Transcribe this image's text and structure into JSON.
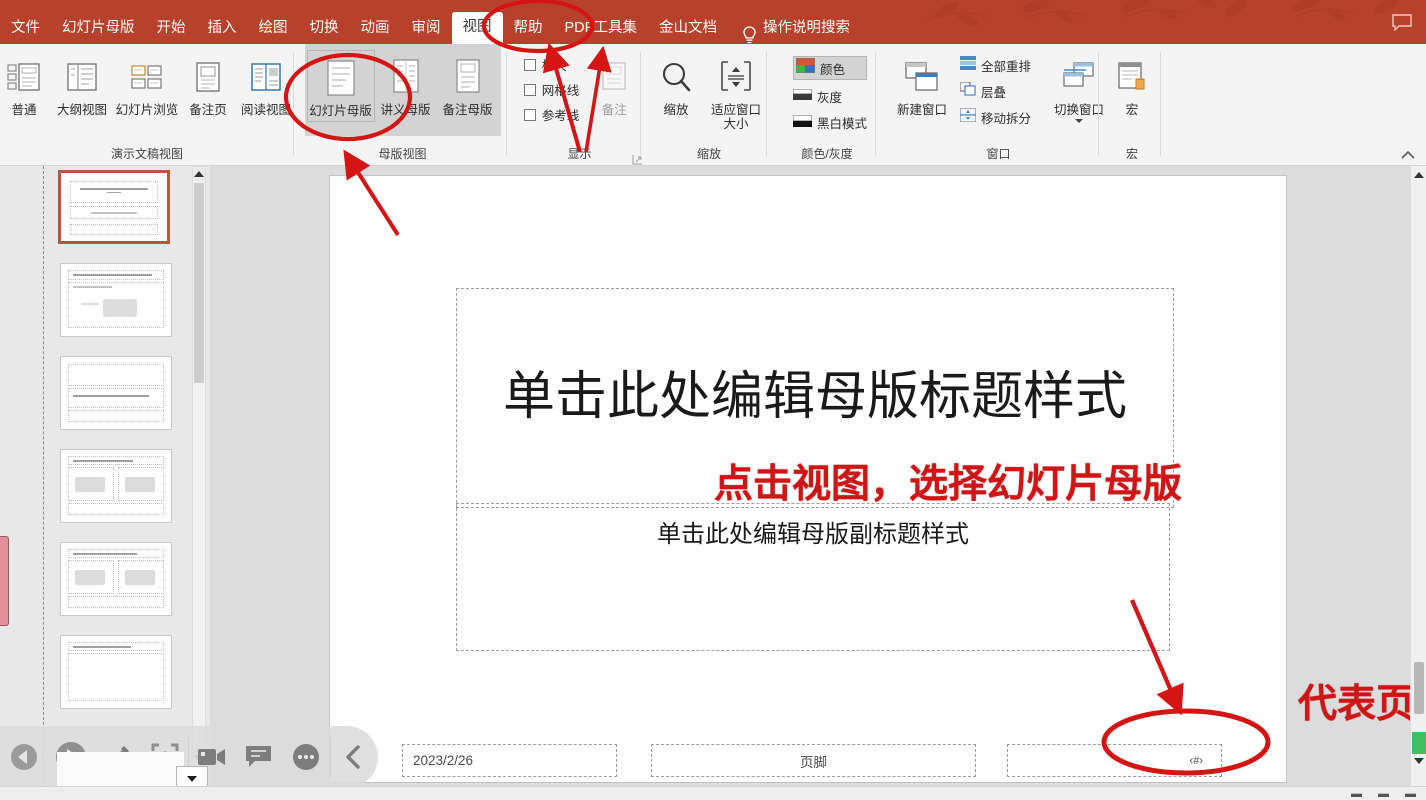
{
  "header": {
    "menu_items": [
      {
        "label": "文件",
        "active": false
      },
      {
        "label": "幻灯片母版",
        "active": false
      },
      {
        "label": "开始",
        "active": false
      },
      {
        "label": "插入",
        "active": false
      },
      {
        "label": "绘图",
        "active": false
      },
      {
        "label": "切换",
        "active": false
      },
      {
        "label": "动画",
        "active": false
      },
      {
        "label": "审阅",
        "active": false
      },
      {
        "label": "视图",
        "active": true
      },
      {
        "label": "帮助",
        "active": false
      },
      {
        "label": "PDF工具集",
        "active": false
      },
      {
        "label": "金山文档",
        "active": false
      }
    ],
    "search_hint": "操作说明搜索",
    "bulb_icon": "lightbulb-icon",
    "share_icon": "comment-share-icon",
    "background_color": "#b7412a"
  },
  "ribbon": {
    "groups": [
      {
        "name": "presentation-views",
        "label": "演示文稿视图",
        "buttons": [
          {
            "label": "普通",
            "icon": "normal-view-icon",
            "active": false
          },
          {
            "label": "大纲视图",
            "icon": "outline-view-icon",
            "active": false
          },
          {
            "label": "幻灯片浏览",
            "icon": "slide-sorter-icon",
            "active": false
          },
          {
            "label": "备注页",
            "icon": "notes-page-icon",
            "active": false
          },
          {
            "label": "阅读视图",
            "icon": "reading-view-icon",
            "active": false
          }
        ]
      },
      {
        "name": "master-views",
        "label": "母版视图",
        "buttons": [
          {
            "label": "幻灯片母版",
            "icon": "slide-master-icon",
            "active": true
          },
          {
            "label": "讲义母版",
            "icon": "handout-master-icon",
            "active": false
          },
          {
            "label": "备注母版",
            "icon": "notes-master-icon",
            "active": false
          }
        ]
      },
      {
        "name": "display",
        "label": "显示",
        "checkboxes": [
          {
            "label": "标尺",
            "checked": false
          },
          {
            "label": "网格线",
            "checked": false
          },
          {
            "label": "参考线",
            "checked": false
          }
        ],
        "buttons": [
          {
            "label": "备注",
            "icon": "notes-icon",
            "disabled": true
          }
        ],
        "has_dialog_launcher": true
      },
      {
        "name": "zoom",
        "label": "缩放",
        "buttons": [
          {
            "label": "缩放",
            "icon": "magnifier-icon"
          },
          {
            "label": "适应窗口大小",
            "icon": "fit-window-icon"
          }
        ]
      },
      {
        "name": "color-grayscale",
        "label": "颜色/灰度",
        "items": [
          {
            "label": "颜色",
            "icon": "color-swatch-icon",
            "active": true
          },
          {
            "label": "灰度",
            "icon": "grayscale-icon",
            "active": false
          },
          {
            "label": "黑白模式",
            "icon": "blackwhite-icon",
            "active": false
          }
        ]
      },
      {
        "name": "window",
        "label": "窗口",
        "buttons": [
          {
            "label": "新建窗口",
            "icon": "new-window-icon"
          }
        ],
        "items": [
          {
            "label": "全部重排",
            "icon": "arrange-all-icon"
          },
          {
            "label": "层叠",
            "icon": "cascade-icon"
          },
          {
            "label": "移动拆分",
            "icon": "move-split-icon"
          },
          {
            "label": "切换窗口",
            "icon": "switch-window-icon"
          }
        ]
      },
      {
        "name": "macros",
        "label": "宏",
        "buttons": [
          {
            "label": "宏",
            "icon": "macro-icon"
          }
        ]
      }
    ],
    "collapse_icon": "chevron-up-icon"
  },
  "slide_panel": {
    "selected_index": 0,
    "scrollbar": {
      "up": "triangle-up-icon",
      "down": "triangle-down-icon"
    },
    "thumbnails": [
      {
        "name": "slide-thumbnail-1",
        "selected": true
      },
      {
        "name": "slide-thumbnail-2",
        "selected": false
      },
      {
        "name": "slide-thumbnail-3",
        "selected": false
      },
      {
        "name": "slide-thumbnail-4",
        "selected": false
      },
      {
        "name": "slide-thumbnail-5",
        "selected": false
      },
      {
        "name": "slide-thumbnail-6",
        "selected": false
      }
    ]
  },
  "slide": {
    "title_placeholder": "单击此处编辑母版标题样式",
    "subtitle_placeholder": "单击此处编辑母版副标题样式",
    "footer_date": "2023/2/26",
    "footer_center": "页脚",
    "footer_number": "‹#›"
  },
  "annotations": {
    "instruction": "点击视图，选择幻灯片母版",
    "page_number_note": "代表页码",
    "color": "#cf1616",
    "shapes": [
      {
        "type": "ellipse",
        "name": "ellipse-view-tab"
      },
      {
        "type": "ellipse",
        "name": "ellipse-slide-master-button"
      },
      {
        "type": "ellipse",
        "name": "ellipse-page-number-placeholder"
      },
      {
        "type": "arrow",
        "name": "arrow-to-slide-master-button"
      },
      {
        "type": "arrow",
        "name": "arrow-to-display-group"
      },
      {
        "type": "arrow",
        "name": "arrow-to-notes-button"
      },
      {
        "type": "arrow",
        "name": "arrow-to-page-number"
      }
    ]
  },
  "float_toolbar": {
    "buttons": [
      {
        "icon": "previous-icon",
        "name": "previous-button"
      },
      {
        "icon": "play-icon",
        "name": "play-button"
      },
      {
        "icon": "pen-icon",
        "name": "pen-button"
      },
      {
        "icon": "spotlight-icon",
        "name": "spotlight-button"
      },
      {
        "icon": "video-icon",
        "name": "record-video-button"
      },
      {
        "icon": "comment-icon",
        "name": "comment-button"
      },
      {
        "icon": "more-icon",
        "name": "more-options-button"
      },
      {
        "icon": "chevron-left-icon",
        "name": "collapse-toolbar-button"
      }
    ]
  },
  "right_scrollbar": {
    "up_icon": "triangle-up-icon",
    "down_icon": "triangle-down-icon"
  },
  "status_bar": {
    "left_text": "",
    "right_items": []
  }
}
